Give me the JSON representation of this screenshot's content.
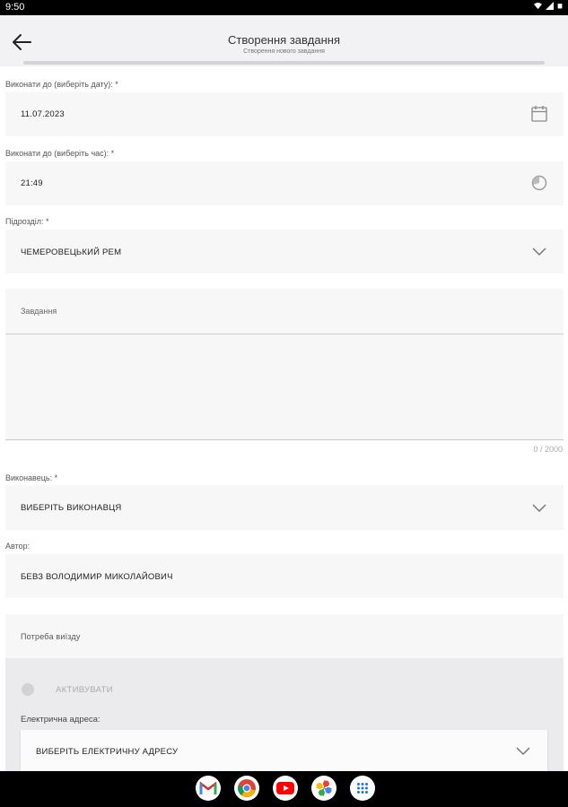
{
  "status_bar": {
    "time": "9:50"
  },
  "header": {
    "title": "Створення завдання",
    "subtitle": "Створення нового завдання"
  },
  "form": {
    "date": {
      "label": "Виконати до (виберіть дату): *",
      "value": "11.07.2023",
      "icon": "calendar-icon"
    },
    "time": {
      "label": "Виконати до (виберіть час): *",
      "value": "21:49",
      "icon": "clock-icon"
    },
    "division": {
      "label": "Підрозділ: *",
      "value": "ЧЕМЕРОВЕЦЬКИЙ РЕМ",
      "icon": "chevron-down-icon"
    },
    "task": {
      "placeholder": "Завдання",
      "counter": "0 / 2000"
    },
    "executor": {
      "label": "Виконавець: *",
      "value": "ВИБЕРІТЬ ВИКОНАВЦЯ",
      "icon": "chevron-down-icon"
    },
    "author": {
      "label": "Автор:",
      "value": "БЕВЗ ВОЛОДИМИР МИКОЛАЙОВИЧ"
    },
    "trip": {
      "label": "Потреба виїзду",
      "toggle_label": "АКТИВУВАТИ",
      "address_label": "Електрична адреса:",
      "address_value": "ВИБЕРІТЬ ЕЛЕКТРИЧНУ АДРЕСУ"
    }
  },
  "dock": {
    "apps": [
      "gmail-icon",
      "chrome-icon",
      "youtube-icon",
      "photos-icon",
      "app-drawer-icon"
    ]
  },
  "colors": {
    "appbar_bg": "#f2f2f4",
    "field_bg": "#f7f7f7",
    "panel_bg": "#ebebed"
  }
}
